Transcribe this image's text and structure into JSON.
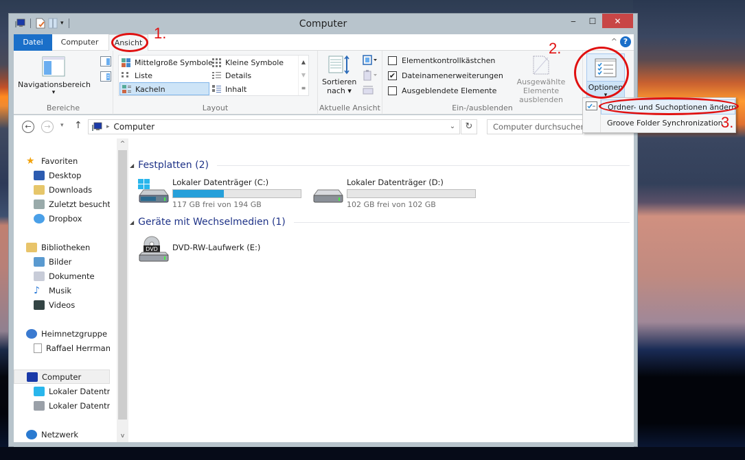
{
  "window": {
    "title": "Computer",
    "controls": {
      "minimize": "‒",
      "maximize": "☐",
      "close": "✕"
    }
  },
  "tabs": {
    "file": "Datei",
    "computer": "Computer",
    "view": "Ansicht"
  },
  "ribbon": {
    "collapse_icon": "^",
    "help_icon": "?",
    "groups": {
      "panes": {
        "label": "Bereiche",
        "navigation_pane": "Navigationsbereich",
        "dropdown_arrow": "▾"
      },
      "layout": {
        "label": "Layout",
        "items": [
          {
            "label": "Mittelgroße Symbole",
            "selected": false
          },
          {
            "label": "Kleine Symbole",
            "selected": false
          },
          {
            "label": "Liste",
            "selected": false
          },
          {
            "label": "Details",
            "selected": false
          },
          {
            "label": "Kacheln",
            "selected": true
          },
          {
            "label": "Inhalt",
            "selected": false
          }
        ]
      },
      "current_view": {
        "label": "Aktuelle Ansicht",
        "sort_by_line1": "Sortieren",
        "sort_by_line2": "nach ▾"
      },
      "show_hide": {
        "label": "Ein-/ausblenden",
        "checkboxes": [
          {
            "label": "Elementkontrollkästchen",
            "checked": false
          },
          {
            "label": "Dateinamenerweiterungen",
            "checked": true
          },
          {
            "label": "Ausgeblendete Elemente",
            "checked": false
          }
        ],
        "hide_selected_line1": "Ausgewählte",
        "hide_selected_line2": "Elemente ausblenden"
      },
      "options": {
        "label": "Optionen",
        "arrow": "▾"
      }
    }
  },
  "options_menu": {
    "items": [
      {
        "label": "Ordner- und Suchoptionen ändern",
        "highlighted": true
      },
      {
        "label": "Groove Folder Synchronization",
        "highlighted": false
      }
    ]
  },
  "address_bar": {
    "back": "←",
    "forward": "→",
    "recent": "▾",
    "up": "↑",
    "separator": "▸",
    "path": "Computer",
    "dropdown": "⌄",
    "refresh": "↻",
    "search_placeholder": "Computer durchsuchen"
  },
  "nav_pane": {
    "items": [
      {
        "label": "Favoriten",
        "icon": "star-icon",
        "level": 0
      },
      {
        "label": "Desktop",
        "icon": "desktop-icon",
        "level": 1
      },
      {
        "label": "Downloads",
        "icon": "downloads-icon",
        "level": 1
      },
      {
        "label": "Zuletzt besucht",
        "icon": "recent-places-icon",
        "level": 1
      },
      {
        "label": "Dropbox",
        "icon": "dropbox-icon",
        "level": 1
      },
      {
        "label": "Bibliotheken",
        "icon": "libraries-icon",
        "level": 0
      },
      {
        "label": "Bilder",
        "icon": "pictures-icon",
        "level": 1
      },
      {
        "label": "Dokumente",
        "icon": "documents-icon",
        "level": 1
      },
      {
        "label": "Musik",
        "icon": "music-icon",
        "level": 1
      },
      {
        "label": "Videos",
        "icon": "videos-icon",
        "level": 1
      },
      {
        "label": "Heimnetzgruppe",
        "icon": "homegroup-icon",
        "level": 0
      },
      {
        "label": "Raffael Herrmann",
        "icon": "user-file-icon",
        "level": 1
      },
      {
        "label": "Computer",
        "icon": "computer-icon",
        "level": 0,
        "selected": true
      },
      {
        "label": "Lokaler Datenträger (C:)",
        "icon": "system-drive-icon",
        "level": 1
      },
      {
        "label": "Lokaler Datenträger (D:)",
        "icon": "drive-icon",
        "level": 1
      },
      {
        "label": "Netzwerk",
        "icon": "network-icon",
        "level": 0
      }
    ],
    "scroll_up": "^",
    "scroll_down": "v"
  },
  "content": {
    "groups": [
      {
        "title": "Festplatten (2)",
        "items": [
          {
            "name": "Lokaler Datenträger (C:)",
            "free_text": "117 GB frei von 194 GB",
            "used_fraction": 0.397,
            "icon": "system-drive-icon"
          },
          {
            "name": "Lokaler Datenträger (D:)",
            "free_text": "102 GB frei von 102 GB",
            "used_fraction": 0.0,
            "icon": "drive-icon"
          }
        ]
      },
      {
        "title": "Geräte mit Wechselmedien (1)",
        "items": [
          {
            "name": "DVD-RW-Laufwerk (E:)",
            "icon": "dvd-drive-icon",
            "badge": "DVD"
          }
        ]
      }
    ]
  },
  "annotations": {
    "step1": "1.",
    "step2": "2.",
    "step3": "3."
  },
  "colors": {
    "accent": "#1a6fc9",
    "usage_bar": "#26a0da",
    "annotation": "#e01010",
    "group_header": "#1e3287"
  }
}
